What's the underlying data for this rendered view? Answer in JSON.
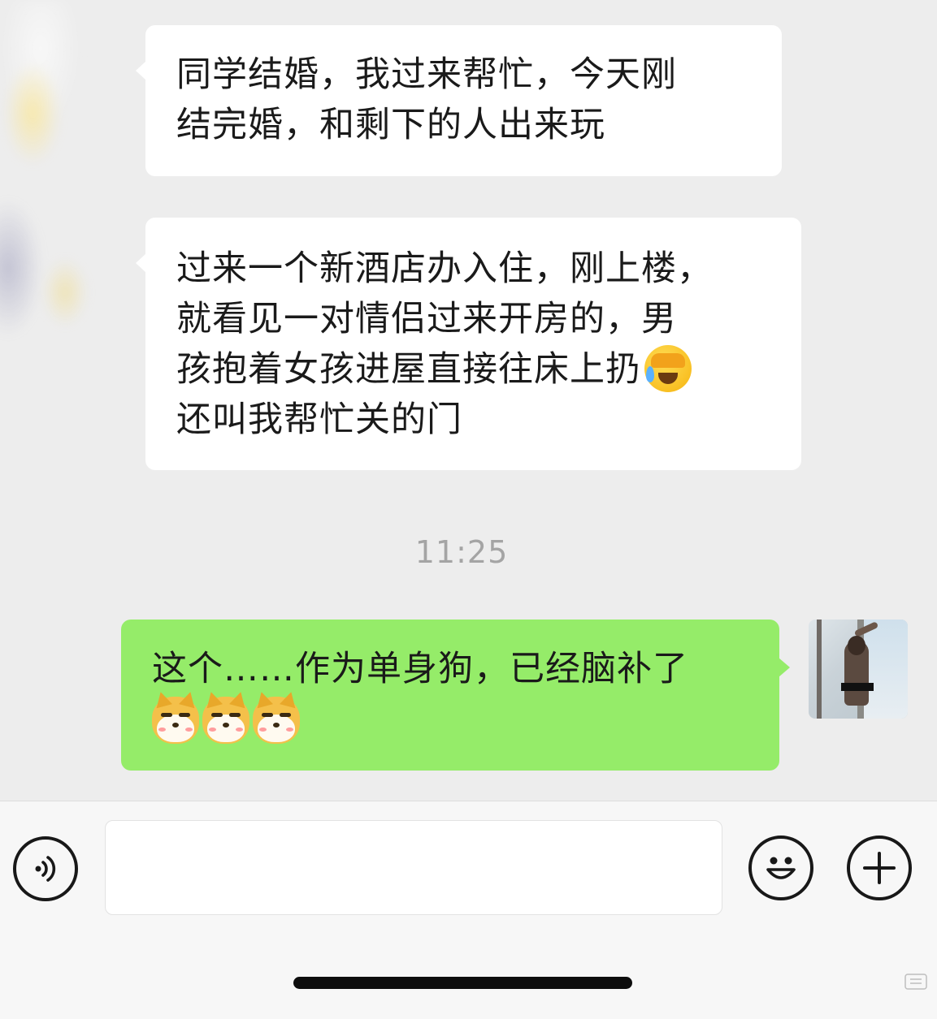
{
  "messages": [
    {
      "direction": "incoming",
      "lines": [
        "同学结婚，我过来帮忙，今天刚",
        "结完婚，和剩下的人出来玩"
      ]
    },
    {
      "direction": "incoming",
      "lines": [
        "过来一个新酒店办入住，刚上楼，",
        "就看见一对情侣过来开房的，男",
        "孩抱着女孩进屋直接往床上扔",
        "还叫我帮忙关的门"
      ],
      "trailing_emoji": "face-with-tears-of-joy-covering-face-emoji"
    },
    {
      "direction": "outgoing",
      "lines": [
        "这个……作为单身狗，已经脑补了"
      ],
      "emojis": [
        "doge-emoji",
        "doge-emoji",
        "doge-emoji"
      ]
    }
  ],
  "timestamp": "11:25",
  "input_bar": {
    "voice_icon": "voice-icon",
    "emoji_icon": "smiley-face-icon",
    "plus_icon": "plus-icon",
    "input_value": ""
  },
  "colors": {
    "background": "#ededed",
    "incoming_bubble": "#ffffff",
    "outgoing_bubble": "#95ec69",
    "timestamp_text": "#a4a4a4"
  }
}
